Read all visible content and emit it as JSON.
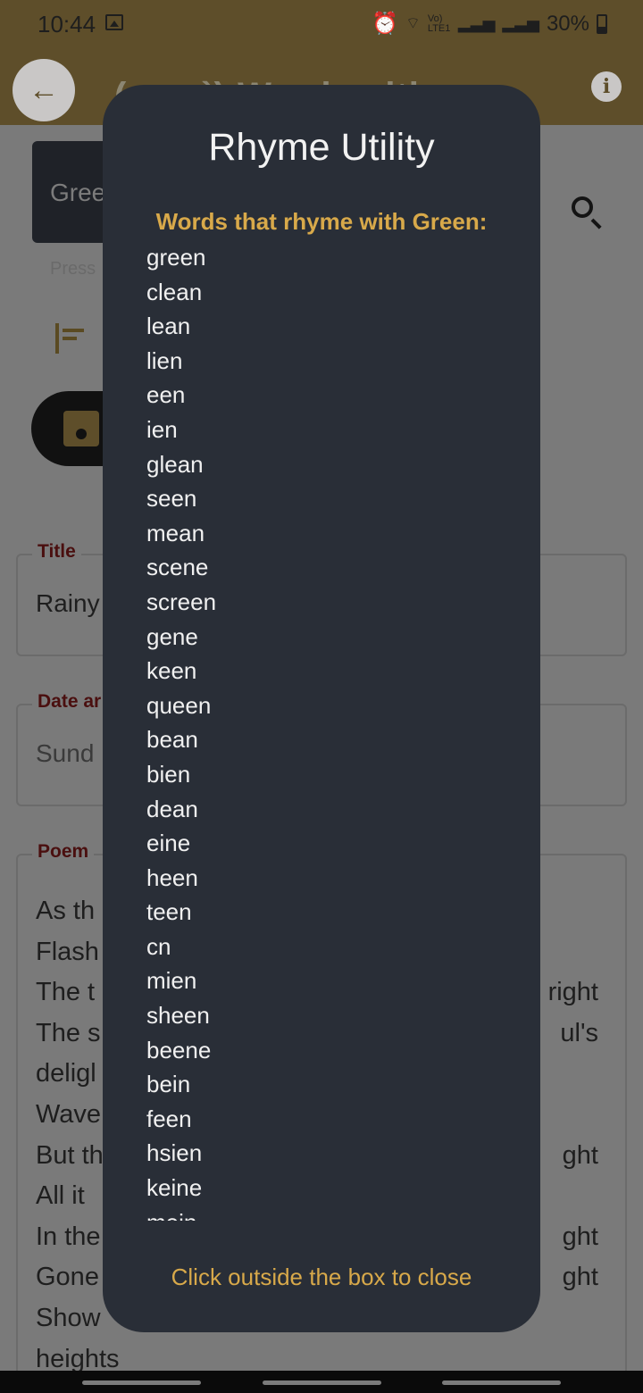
{
  "status": {
    "time": "10:44",
    "network": "Vo) LTE1",
    "battery": "30%"
  },
  "appbar": {
    "title": "(･・･`) Wordsmith"
  },
  "background": {
    "search_value": "Gree",
    "hint": "Press",
    "fields": [
      {
        "label": "Title",
        "value": "Rainy"
      },
      {
        "label": "Date ar",
        "value": "Sund"
      },
      {
        "label": "Poem"
      }
    ],
    "poem_left": [
      "As th",
      "Flash",
      "The t",
      "The s",
      "deligl",
      "Wave",
      "But th",
      "All it",
      "In the",
      "Gone",
      "Show",
      "heights"
    ],
    "poem_right": [
      "",
      "",
      "right",
      "ul's",
      "",
      "",
      "ght",
      "",
      "ght",
      "ght",
      "",
      ""
    ]
  },
  "modal": {
    "title": "Rhyme Utility",
    "subtitle": "Words that rhyme with Green:",
    "rhymes": [
      "green",
      "clean",
      "lean",
      "lien",
      "een",
      "ien",
      "glean",
      "seen",
      "mean",
      "scene",
      "screen",
      "gene",
      "keen",
      "queen",
      "bean",
      "bien",
      "dean",
      "eine",
      "heen",
      "teen",
      "cn",
      "mien",
      "sheen",
      "beene",
      "bein",
      "feen",
      "hsien",
      "keine",
      "mein"
    ],
    "footer": "Click outside the box to close"
  },
  "colors": {
    "accent": "#d8a94a",
    "modal_bg": "#292e37",
    "appbar": "#5e4e2a"
  }
}
